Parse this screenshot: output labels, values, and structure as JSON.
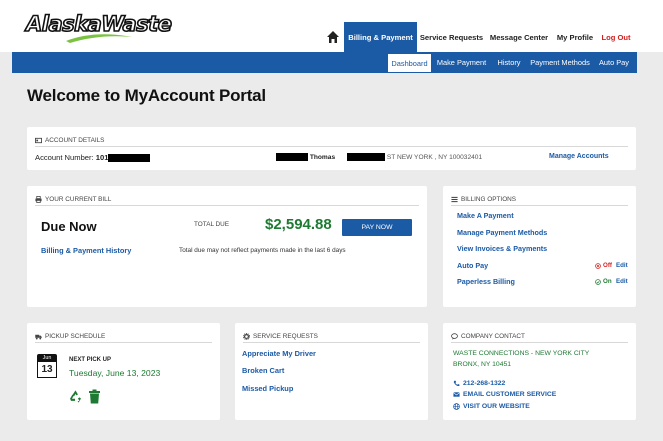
{
  "brand": {
    "logo_text": "AlaskaWaste"
  },
  "nav": {
    "items": [
      {
        "label": "Billing & Payment",
        "active": true
      },
      {
        "label": "Service Requests"
      },
      {
        "label": "Message Center"
      },
      {
        "label": "My Profile"
      },
      {
        "label": "Log Out"
      }
    ]
  },
  "subnav": {
    "items": [
      {
        "label": "Dashboard",
        "active": true
      },
      {
        "label": "Make Payment"
      },
      {
        "label": "History"
      },
      {
        "label": "Payment Methods"
      },
      {
        "label": "Auto Pay"
      }
    ]
  },
  "page": {
    "title": "Welcome to MyAccount Portal"
  },
  "account_details": {
    "heading": "ACCOUNT DETAILS",
    "number_label": "Account Number:",
    "number_prefix": "101",
    "name": "Thomas",
    "address": "ST NEW YORK , NY 100032401",
    "manage_link": "Manage Accounts"
  },
  "current_bill": {
    "heading": "YOUR CURRENT BILL",
    "due_now": "Due Now",
    "total_due_label": "TOTAL DUE",
    "total_due": "$2,594.88",
    "pay_button": "PAY NOW",
    "history_link": "Billing & Payment History",
    "note": "Total due may not reflect payments made in the last 6 days"
  },
  "billing_options": {
    "heading": "BILLING OPTIONS",
    "links": [
      "Make A Payment",
      "Manage Payment Methods",
      "View Invoices & Payments"
    ],
    "auto_pay": {
      "label": "Auto Pay",
      "status": "Off",
      "edit": "Edit"
    },
    "paperless": {
      "label": "Paperless Billing",
      "status": "On",
      "edit": "Edit"
    }
  },
  "pickup": {
    "heading": "PICKUP SCHEDULE",
    "cal_month": "Jun",
    "cal_day": "13",
    "next_label": "NEXT PICK UP",
    "date": "Tuesday, June 13, 2023"
  },
  "service_requests": {
    "heading": "SERVICE REQUESTS",
    "links": [
      "Appreciate My Driver",
      "Broken Cart",
      "Missed Pickup"
    ]
  },
  "company_contact": {
    "heading": "COMPANY CONTACT",
    "company": "WASTE CONNECTIONS - NEW YORK CITY",
    "city": "BRONX, NY 10451",
    "phone": "212-268-1322",
    "email_link": "EMAIL CUSTOMER SERVICE",
    "website_link": "VISIT OUR WEBSITE"
  },
  "colors": {
    "primary": "#1b5aa5",
    "green": "#1e7a32",
    "red": "#d31f1f",
    "background": "#ebebeb"
  }
}
